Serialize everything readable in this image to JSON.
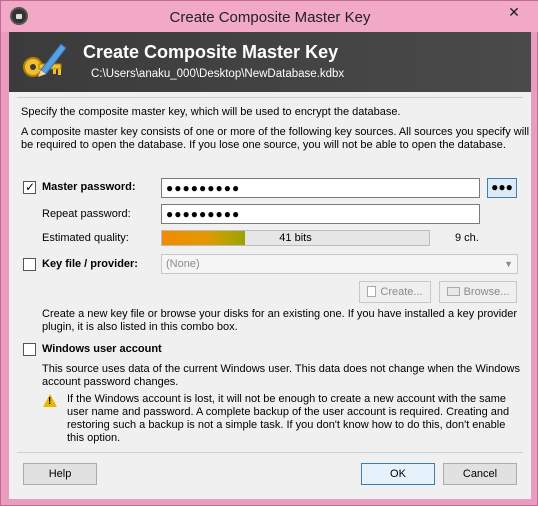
{
  "window": {
    "title": "Create Composite Master Key",
    "close_glyph": "✕"
  },
  "banner": {
    "title": "Create Composite Master Key",
    "path": "C:\\Users\\anaku_000\\Desktop\\NewDatabase.kdbx",
    "icon": "key-pencil-icon"
  },
  "intro": {
    "line1": "Specify the composite master key, which will be used to encrypt the database.",
    "line2": "A composite master key consists of one or more of the following key sources. All sources you specify will",
    "line3": "be required to open the database.  If you lose one source, you will not be able to open the database."
  },
  "master_password": {
    "label": "Master password:",
    "checked": true,
    "value": "●●●●●●●●●",
    "reveal_label": "●●●",
    "repeat_label": "Repeat password:",
    "repeat_value": "●●●●●●●●●",
    "quality_label": "Estimated quality:",
    "quality_bits": "41 bits",
    "quality_fraction": 0.31,
    "char_count": "9 ch."
  },
  "key_file": {
    "label": "Key file / provider:",
    "checked": false,
    "select_value": "(None)",
    "create_label": "Create...",
    "browse_label": "Browse...",
    "desc1": "Create a new key file or browse your disks for an existing one. If you have installed a key provider",
    "desc2": "plugin, it is also listed in this combo box."
  },
  "windows_account": {
    "label": "Windows user account",
    "checked": false,
    "desc1": "This source uses data of the current Windows user. This data does not change when the Windows",
    "desc2": "account password changes.",
    "warn1": "If the Windows account is lost, it will not be enough to create a new account with the same",
    "warn2": "user name and password. A complete backup of the user account is required. Creating and",
    "warn3": "restoring such a backup is not a simple task. If you don't know how to do this, don't enable",
    "warn4": "this option."
  },
  "footer": {
    "help_label": "Help",
    "ok_label": "OK",
    "cancel_label": "Cancel"
  },
  "colors": {
    "banner_bg": "#3b3b3b",
    "frame_accent": "#eb9bc0",
    "quality_start": "#f28a00",
    "quality_end": "#9aa200"
  }
}
